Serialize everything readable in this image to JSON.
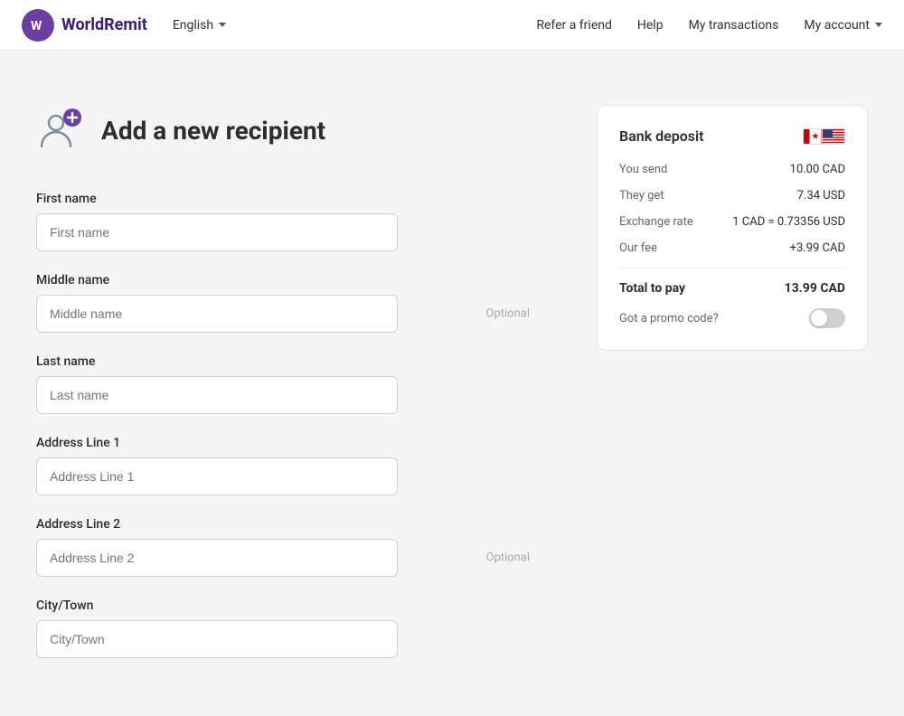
{
  "header": {
    "logo_text": "WorldRemit",
    "language_label": "English",
    "nav": {
      "refer_label": "Refer a friend",
      "help_label": "Help",
      "transactions_label": "My transactions",
      "account_label": "My account"
    }
  },
  "form": {
    "page_title": "Add a new recipient",
    "fields": {
      "first_name_label": "First name",
      "first_name_placeholder": "First name",
      "middle_name_label": "Middle name",
      "middle_name_placeholder": "Middle name",
      "middle_name_optional": "Optional",
      "last_name_label": "Last name",
      "last_name_placeholder": "Last name",
      "address_line1_label": "Address Line 1",
      "address_line1_placeholder": "Address Line 1",
      "address_line2_label": "Address Line 2",
      "address_line2_placeholder": "Address Line 2",
      "address_line2_optional": "Optional",
      "city_label": "City/Town"
    }
  },
  "summary": {
    "title": "Bank deposit",
    "you_send_label": "You send",
    "you_send_value": "10.00 CAD",
    "they_get_label": "They get",
    "they_get_value": "7.34 USD",
    "exchange_rate_label": "Exchange rate",
    "exchange_rate_value": "1 CAD = 0.73356 USD",
    "fee_label": "Our fee",
    "fee_value": "+3.99 CAD",
    "total_label": "Total to pay",
    "total_value": "13.99 CAD",
    "promo_label": "Got a promo code?"
  }
}
